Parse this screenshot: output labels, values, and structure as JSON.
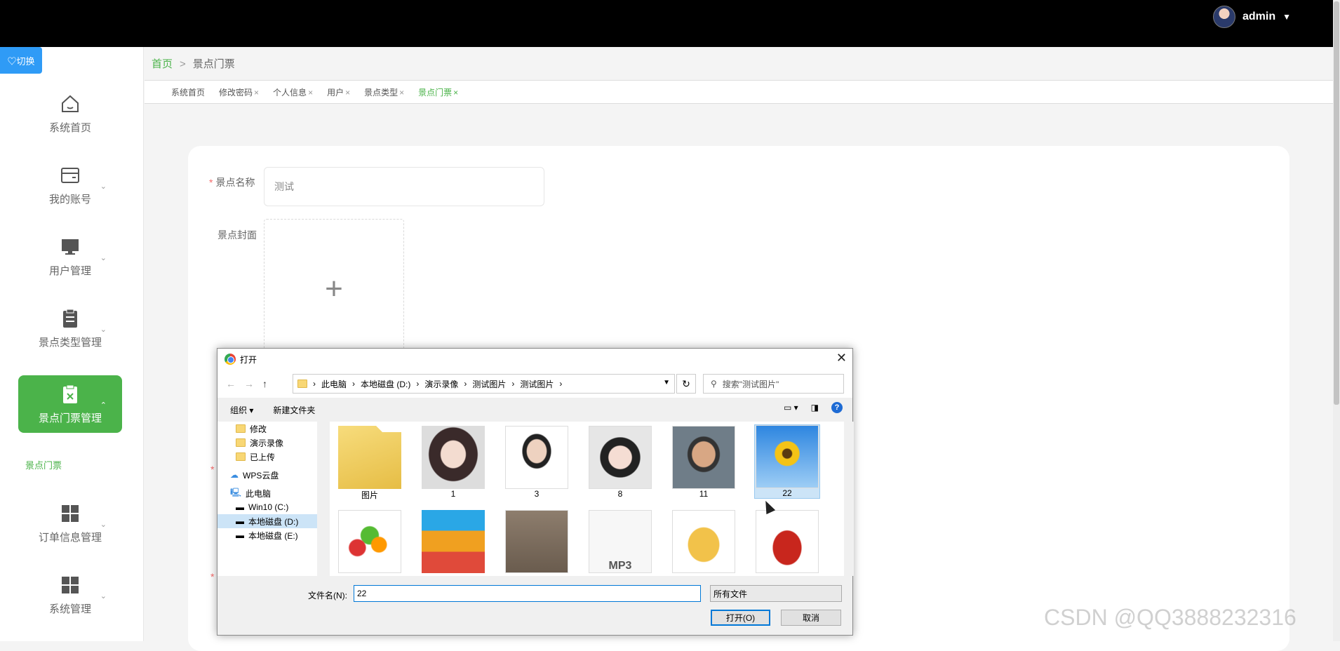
{
  "topbar": {
    "username": "admin",
    "caret": "▼"
  },
  "switch_label": "♡切换",
  "sidebar": {
    "items": [
      {
        "label": "系统首页",
        "icon": "home-icon"
      },
      {
        "label": "我的账号",
        "icon": "wallet-icon"
      },
      {
        "label": "用户管理",
        "icon": "monitor-icon"
      },
      {
        "label": "景点类型管理",
        "icon": "clipboard-icon"
      },
      {
        "label": "景点门票管理",
        "icon": "clipboard-x-icon"
      },
      {
        "label": "订单信息管理",
        "icon": "grid-icon"
      },
      {
        "label": "系统管理",
        "icon": "grid-icon"
      }
    ],
    "submenu": "景点门票"
  },
  "breadcrumb": {
    "home": "首页",
    "sep": ">",
    "current": "景点门票"
  },
  "tabs": [
    {
      "label": "系统首页",
      "close": ""
    },
    {
      "label": "修改密码",
      "close": "×"
    },
    {
      "label": "个人信息",
      "close": "×"
    },
    {
      "label": "用户",
      "close": "×"
    },
    {
      "label": "景点类型",
      "close": "×"
    },
    {
      "label": "景点门票",
      "close": "×"
    }
  ],
  "form": {
    "name_label": "景点名称",
    "name_value": "测试",
    "cover_label": "景点封面",
    "upload_plus": "+",
    "required_mark": "*"
  },
  "dialog": {
    "title": "打开",
    "close": "✕",
    "path": [
      "此电脑",
      "本地磁盘 (D:)",
      "演示录像",
      "测试图片",
      "测试图片"
    ],
    "search_placeholder": "搜索\"测试图片\"",
    "organize": "组织 ▾",
    "new_folder": "新建文件夹",
    "tree": [
      {
        "label": "修改",
        "type": "folder"
      },
      {
        "label": "演示录像",
        "type": "folder"
      },
      {
        "label": "已上传",
        "type": "folder"
      },
      {
        "label": "WPS云盘",
        "type": "cloud"
      },
      {
        "label": "此电脑",
        "type": "pc"
      },
      {
        "label": "Win10 (C:)",
        "type": "drive"
      },
      {
        "label": "本地磁盘 (D:)",
        "type": "drive"
      },
      {
        "label": "本地磁盘 (E:)",
        "type": "drive"
      }
    ],
    "files": [
      {
        "name": "图片",
        "kind": "folder"
      },
      {
        "name": "1",
        "kind": "photo"
      },
      {
        "name": "3",
        "kind": "photo"
      },
      {
        "name": "8",
        "kind": "photo"
      },
      {
        "name": "11",
        "kind": "photo"
      },
      {
        "name": "22",
        "kind": "sunflower"
      }
    ],
    "filename_label": "文件名(N):",
    "filename_value": "22",
    "filetype": "所有文件",
    "open": "打开(O)",
    "cancel": "取消"
  },
  "watermark": "CSDN @QQ3888232316"
}
